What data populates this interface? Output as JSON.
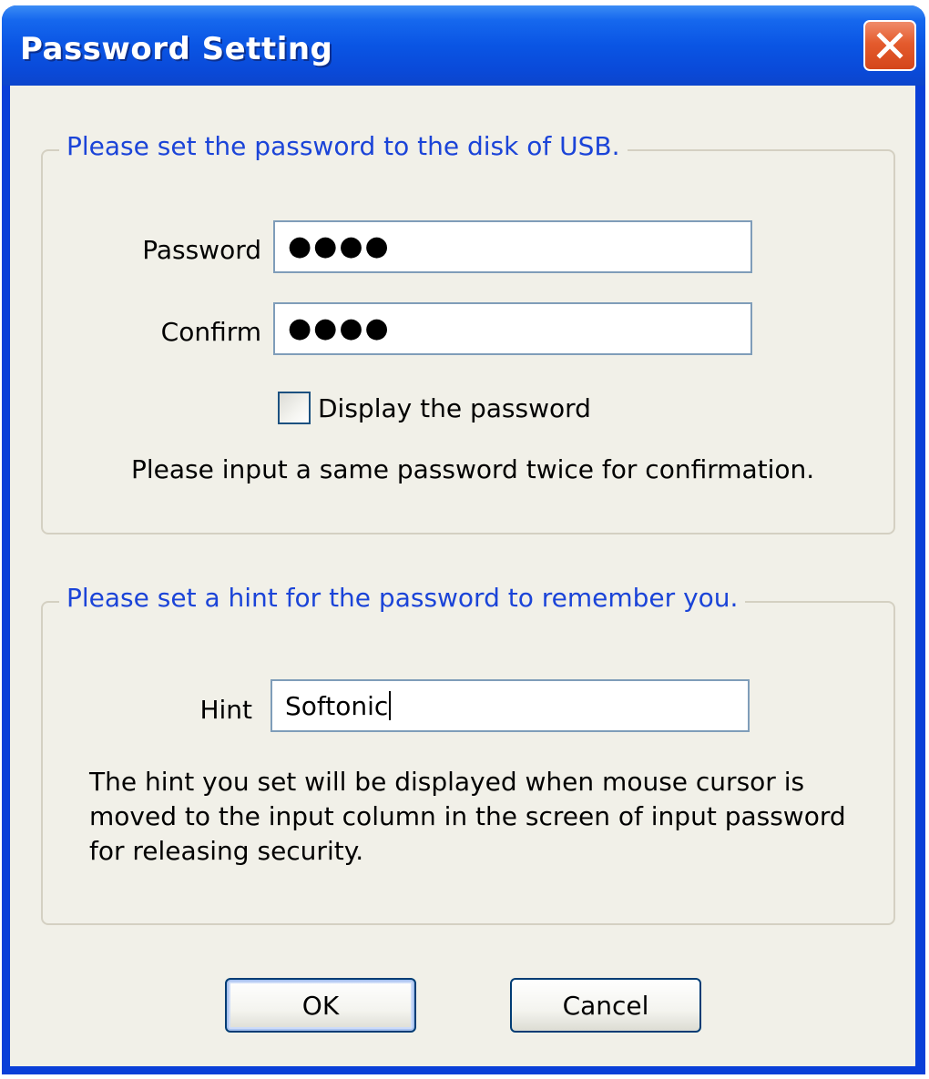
{
  "window": {
    "title": "Password Setting"
  },
  "password_group": {
    "legend": "Please set the password to the disk of USB.",
    "password_label": "Password",
    "password_value": "●●●●",
    "confirm_label": "Confirm",
    "confirm_value": "●●●●",
    "display_checkbox_label": "Display the password",
    "display_checkbox_checked": false,
    "instruction": "Please input a same password twice for confirmation."
  },
  "hint_group": {
    "legend": "Please set a hint for the password to remember you.",
    "hint_label": "Hint",
    "hint_value": "Softonic",
    "description": "The hint you set will be displayed when mouse cursor is moved to the input column in the screen of input password for releasing security."
  },
  "buttons": {
    "ok_label": "OK",
    "cancel_label": "Cancel"
  },
  "icons": {
    "close": "close-icon"
  },
  "colors": {
    "title_bar": "#0a55e4",
    "close_button": "#e45b2d",
    "legend_text": "#1b44d8",
    "dialog_background": "#f1f0e8"
  }
}
